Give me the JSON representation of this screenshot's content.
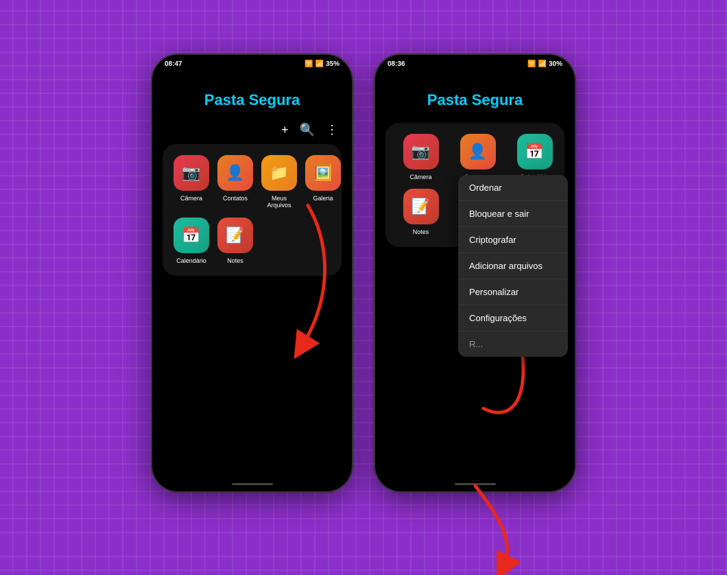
{
  "background": "#8B2FC9",
  "phone1": {
    "status": {
      "time": "08:47",
      "battery": "35%",
      "signal": "📶",
      "wifi": "🛜"
    },
    "title": "Pasta Segura",
    "toolbar": {
      "add": "+",
      "search": "🔍",
      "more": "⋮"
    },
    "apps": [
      {
        "label": "Câmera",
        "icon": "camera"
      },
      {
        "label": "Contatos",
        "icon": "contacts"
      },
      {
        "label": "Meus Arquivos",
        "icon": "files"
      },
      {
        "label": "Galeria",
        "icon": "gallery"
      },
      {
        "label": "Calendário",
        "icon": "calendar"
      },
      {
        "label": "Notes",
        "icon": "notes"
      }
    ]
  },
  "phone2": {
    "status": {
      "time": "08:36",
      "battery": "30%"
    },
    "title": "Pasta Segura",
    "apps_partial": [
      {
        "label": "Câmera",
        "icon": "camera"
      },
      {
        "label": "Contatos",
        "icon": "contacts"
      },
      {
        "label": "Calendário",
        "icon": "calendar"
      },
      {
        "label": "Notes",
        "icon": "notes"
      }
    ],
    "context_menu": [
      "Ordenar",
      "Bloquear e sair",
      "Criptografar",
      "Adicionar arquivos",
      "Personalizar",
      "Configurações",
      "Rascunho"
    ]
  }
}
